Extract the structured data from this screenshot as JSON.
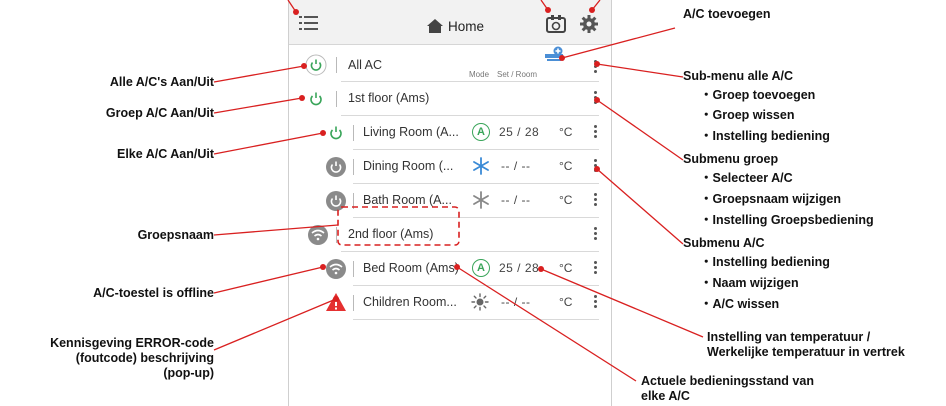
{
  "header": {
    "title": "Home"
  },
  "columns": {
    "mode": "Mode",
    "set_room": "Set / Room"
  },
  "rows": {
    "all": {
      "name": "All AC"
    },
    "group1": {
      "name": "1st floor (Ams)"
    },
    "living": {
      "name": "Living Room (A...",
      "mode": "A",
      "temp": "25 / 28",
      "unit": "°C"
    },
    "dining": {
      "name": "Dining Room (...",
      "temp": "-- / --",
      "unit": "°C"
    },
    "bath": {
      "name": "Bath Room (A...",
      "temp": "-- / --",
      "unit": "°C"
    },
    "group2": {
      "name": "2nd floor (Ams)"
    },
    "bed": {
      "name": "Bed Room (Ams)",
      "mode": "A",
      "temp": "25 / 28",
      "unit": "°C"
    },
    "children": {
      "name": "Children Room...",
      "temp": "-- / --",
      "unit": "°C"
    }
  },
  "annotations": {
    "add_ac": "A/C toevoegen",
    "all_onoff": "Alle A/C's Aan/Uit",
    "group_onoff": "Groep A/C Aan/Uit",
    "each_onoff": "Elke A/C Aan/Uit",
    "group_name": "Groepsnaam",
    "offline": "A/C-toestel is offline",
    "error_l1": "Kennisgeving ERROR-code",
    "error_l2": "(foutcode) beschrijving",
    "error_l3": "(pop-up)",
    "submenu_all": {
      "title": "Sub-menu alle A/C",
      "items": [
        "・Groep toevoegen",
        "・Groep wissen",
        "・Instelling bediening"
      ]
    },
    "submenu_group": {
      "title": "Submenu groep",
      "items": [
        "・Selecteer A/C",
        "・Groepsnaam wijzigen",
        "・Instelling Groepsbediening"
      ]
    },
    "submenu_ac": {
      "title": "Submenu A/C",
      "items": [
        "・Instelling bediening",
        "・Naam wijzigen",
        "・A/C wissen"
      ]
    },
    "temp_l1": "Instelling van temperatuur /",
    "temp_l2": "Werkelijke temperatuur in vertrek",
    "mode_l1": "Actuele bedieningsstand van",
    "mode_l2": "elke A/C"
  },
  "colors": {
    "accent_green": "#3aa55a",
    "annotation_red": "#d92020",
    "cool_blue": "#3a8ad6",
    "error_red": "#e53030"
  }
}
